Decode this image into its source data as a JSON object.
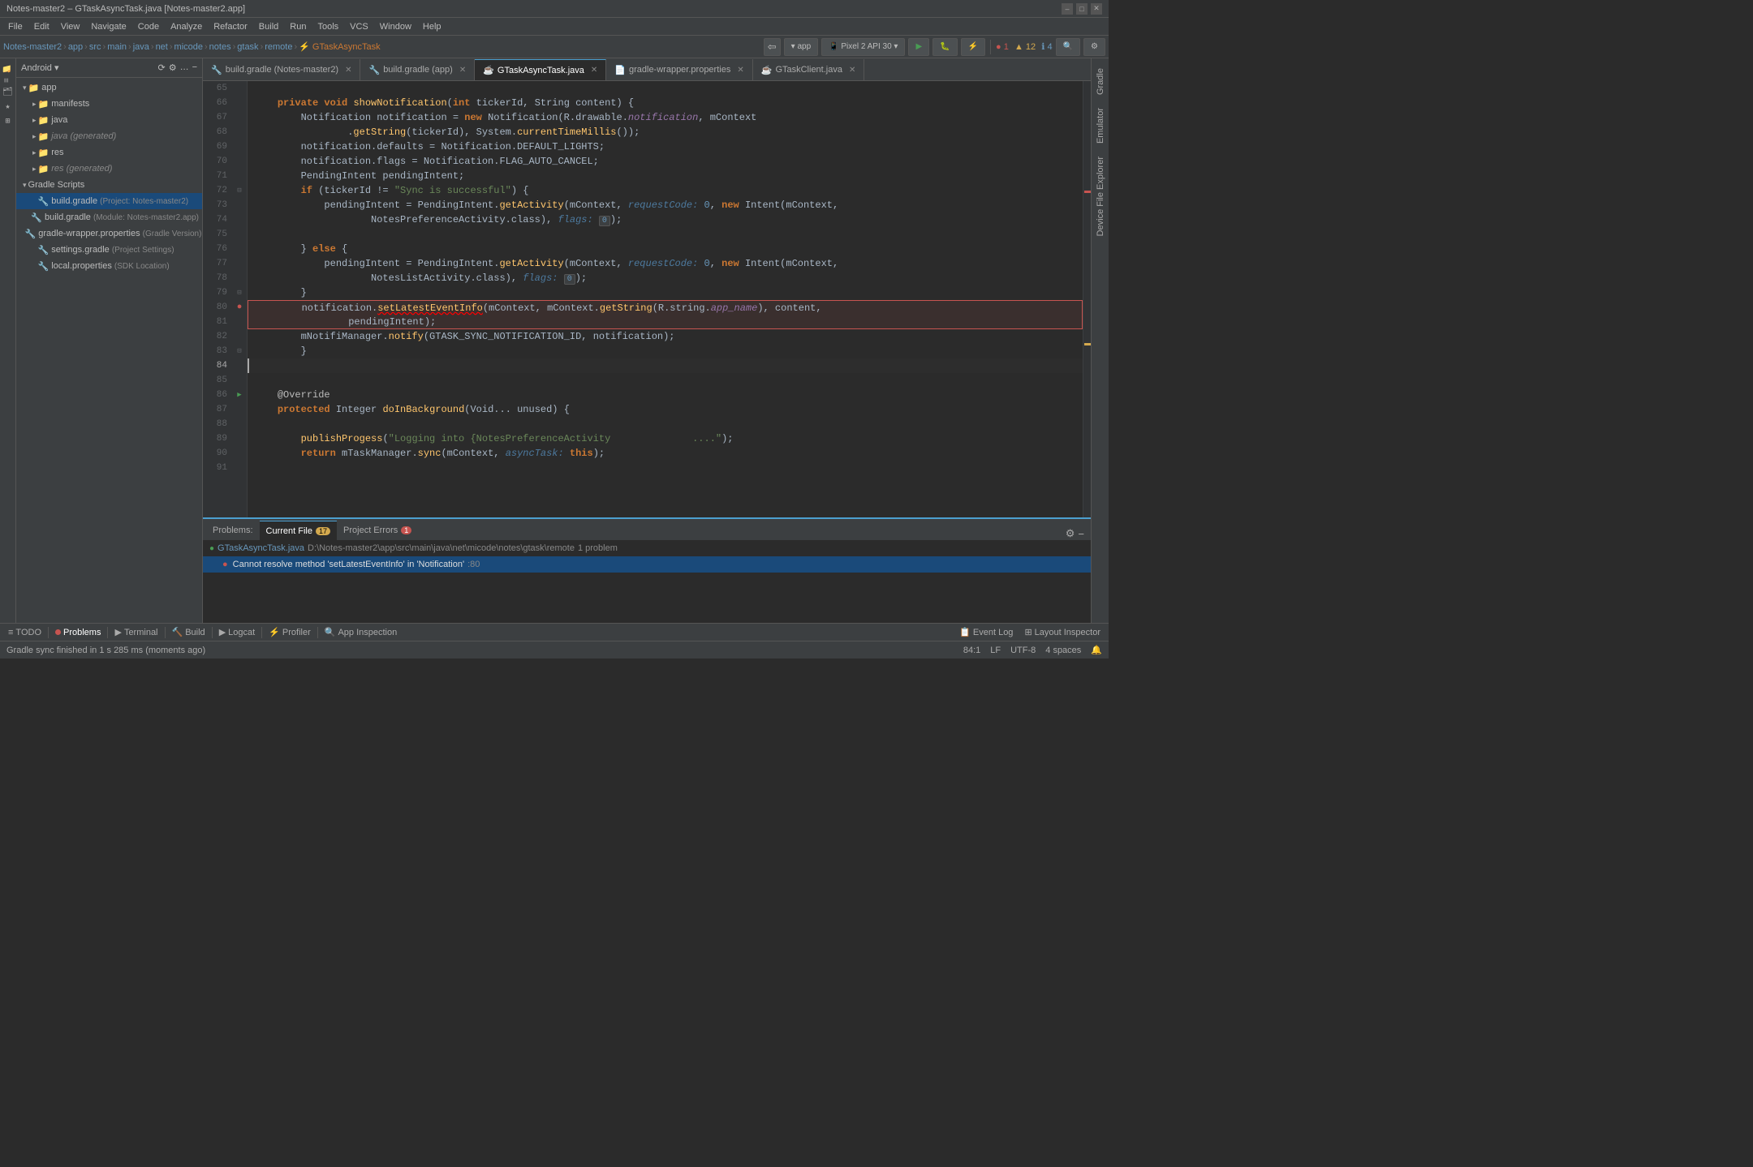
{
  "title_bar": {
    "title": "Notes-master2 – GTaskAsyncTask.java [Notes-master2.app]",
    "minimize": "–",
    "maximize": "□",
    "close": "✕"
  },
  "menu": {
    "items": [
      "File",
      "Edit",
      "View",
      "Navigate",
      "Code",
      "Analyze",
      "Refactor",
      "Build",
      "Run",
      "Tools",
      "VCS",
      "Window",
      "Help"
    ]
  },
  "breadcrumb": {
    "parts": [
      "Notes-master2",
      "app",
      "src",
      "main",
      "java",
      "net",
      "micode",
      "notes",
      "gtask",
      "remote",
      "GTaskAsyncTask"
    ]
  },
  "run_toolbar": {
    "app_label": "▾ app",
    "device_label": "Pixel 2 API 30 ▾",
    "run_label": "▶",
    "debug_label": "🐛",
    "profile_label": "⚡"
  },
  "project": {
    "header": "Android ▾",
    "tree": [
      {
        "level": 0,
        "type": "folder",
        "expanded": true,
        "label": "app",
        "icon": "📁"
      },
      {
        "level": 1,
        "type": "folder",
        "expanded": true,
        "label": "manifests",
        "icon": "📂"
      },
      {
        "level": 1,
        "type": "folder",
        "expanded": true,
        "label": "java",
        "icon": "📂"
      },
      {
        "level": 1,
        "type": "folder",
        "expanded": false,
        "label": "java (generated)",
        "icon": "📂"
      },
      {
        "level": 1,
        "type": "folder",
        "expanded": true,
        "label": "res",
        "icon": "📂"
      },
      {
        "level": 1,
        "type": "folder",
        "expanded": false,
        "label": "res (generated)",
        "icon": "📂"
      },
      {
        "level": 0,
        "type": "section",
        "label": "Gradle Scripts",
        "icon": ""
      },
      {
        "level": 1,
        "type": "gradle",
        "label": "build.gradle (Project: Notes-master2)",
        "icon": "🔧",
        "selected": true
      },
      {
        "level": 1,
        "type": "gradle",
        "label": "build.gradle (Module: Notes-master2.app)",
        "icon": "🔧"
      },
      {
        "level": 1,
        "type": "gradle",
        "label": "gradle-wrapper.properties (Gradle Version)",
        "icon": "🔧"
      },
      {
        "level": 1,
        "type": "gradle",
        "label": "settings.gradle (Project Settings)",
        "icon": "🔧"
      },
      {
        "level": 1,
        "type": "gradle",
        "label": "local.properties (SDK Location)",
        "icon": "🔧"
      }
    ]
  },
  "tabs": [
    {
      "label": "build.gradle (Notes-master2)",
      "type": "gradle",
      "active": false
    },
    {
      "label": "build.gradle (app)",
      "type": "gradle",
      "active": false
    },
    {
      "label": "GTaskAsyncTask.java",
      "type": "java",
      "active": true
    },
    {
      "label": "gradle-wrapper.properties",
      "type": "prop",
      "active": false
    },
    {
      "label": "GTaskClient.java",
      "type": "java",
      "active": false
    }
  ],
  "editor": {
    "lines": [
      {
        "num": 65,
        "code": ""
      },
      {
        "num": 66,
        "code": "    private void showNotification(int tickerId, String content) {"
      },
      {
        "num": 67,
        "code": "        Notification notification = new Notification(R.drawable.notification, mContext"
      },
      {
        "num": 68,
        "code": "                .getString(tickerId), System.currentTimeMillis());"
      },
      {
        "num": 69,
        "code": "        notification.defaults = Notification.DEFAULT_LIGHTS;"
      },
      {
        "num": 70,
        "code": "        notification.flags = Notification.FLAG_AUTO_CANCEL;"
      },
      {
        "num": 71,
        "code": "        PendingIntent pendingIntent;"
      },
      {
        "num": 72,
        "code": "        if (tickerId != \"Sync is successful\") {"
      },
      {
        "num": 73,
        "code": "            pendingIntent = PendingIntent.getActivity(mContext,  requestCode: 0, new Intent(mContext,"
      },
      {
        "num": 74,
        "code": "                    NotesPreferenceActivity.class),  flags: 0);"
      },
      {
        "num": 75,
        "code": ""
      },
      {
        "num": 76,
        "code": "        } else {"
      },
      {
        "num": 77,
        "code": "            pendingIntent = PendingIntent.getActivity(mContext,  requestCode: 0, new Intent(mContext,"
      },
      {
        "num": 78,
        "code": "                    NotesListActivity.class),  flags: 0);"
      },
      {
        "num": 79,
        "code": "        }"
      },
      {
        "num": 80,
        "code": "        notification.setLatestEventInfo(mContext, mContext.getString(R.string.app_name), content,",
        "error": true
      },
      {
        "num": 81,
        "code": "                pendingIntent);",
        "error": true
      },
      {
        "num": 82,
        "code": "        mNotifiManager.notify(GTASK_SYNC_NOTIFICATION_ID, notification);"
      },
      {
        "num": 83,
        "code": "        }"
      },
      {
        "num": 84,
        "code": ""
      },
      {
        "num": 85,
        "code": ""
      },
      {
        "num": 86,
        "code": "    @Override"
      },
      {
        "num": 87,
        "code": "    protected Integer doInBackground(Void... unused) {"
      },
      {
        "num": 88,
        "code": ""
      },
      {
        "num": 89,
        "code": "        publishProgess(\"Logging into {NotesPreferenceActivity              ....\");"
      },
      {
        "num": 90,
        "code": "        return mTaskManager.sync(mContext,  asyncTask: this);"
      },
      {
        "num": 91,
        "code": ""
      }
    ]
  },
  "problems": {
    "tabs": [
      {
        "label": "Problems:",
        "active": false
      },
      {
        "label": "Current File",
        "badge": "17",
        "active": true
      },
      {
        "label": "Project Errors",
        "badge": "1",
        "badge_type": "error",
        "active": false
      }
    ],
    "file_row": "● GTaskAsyncTask.java  D:\\Notes-master2\\app\\src\\main\\java\\net\\micode\\notes\\gtask\\remote  1 problem",
    "items": [
      {
        "icon": "●",
        "text": "Cannot resolve method 'setLatestEventInfo' in 'Notification'",
        "loc": ":80"
      }
    ]
  },
  "status_bar": {
    "sync_message": "Gradle sync finished in 1 s 285 ms (moments ago)",
    "cursor_pos": "84:1",
    "line_ending": "LF",
    "encoding": "UTF-8",
    "indent": "4 spaces"
  },
  "bottom_tools": [
    {
      "label": "TODO",
      "icon": "≡",
      "active": false
    },
    {
      "label": "Problems",
      "icon": "●",
      "active": true,
      "dot": true
    },
    {
      "label": "Terminal",
      "icon": "▶",
      "active": false
    },
    {
      "label": "Build",
      "icon": "🔨",
      "active": false
    },
    {
      "label": "Logcat",
      "icon": "▶",
      "active": false
    },
    {
      "label": "Profiler",
      "icon": "⚡",
      "active": false
    },
    {
      "label": "App Inspection",
      "icon": "🔍",
      "active": false
    }
  ],
  "right_panels": {
    "items": [
      "Gradle",
      "Emulator",
      "Device File Explorer"
    ]
  },
  "error_indicators": {
    "count_error": "1",
    "count_warning": "12",
    "count_info": "4"
  },
  "layout_inspector": "Layout Inspector"
}
